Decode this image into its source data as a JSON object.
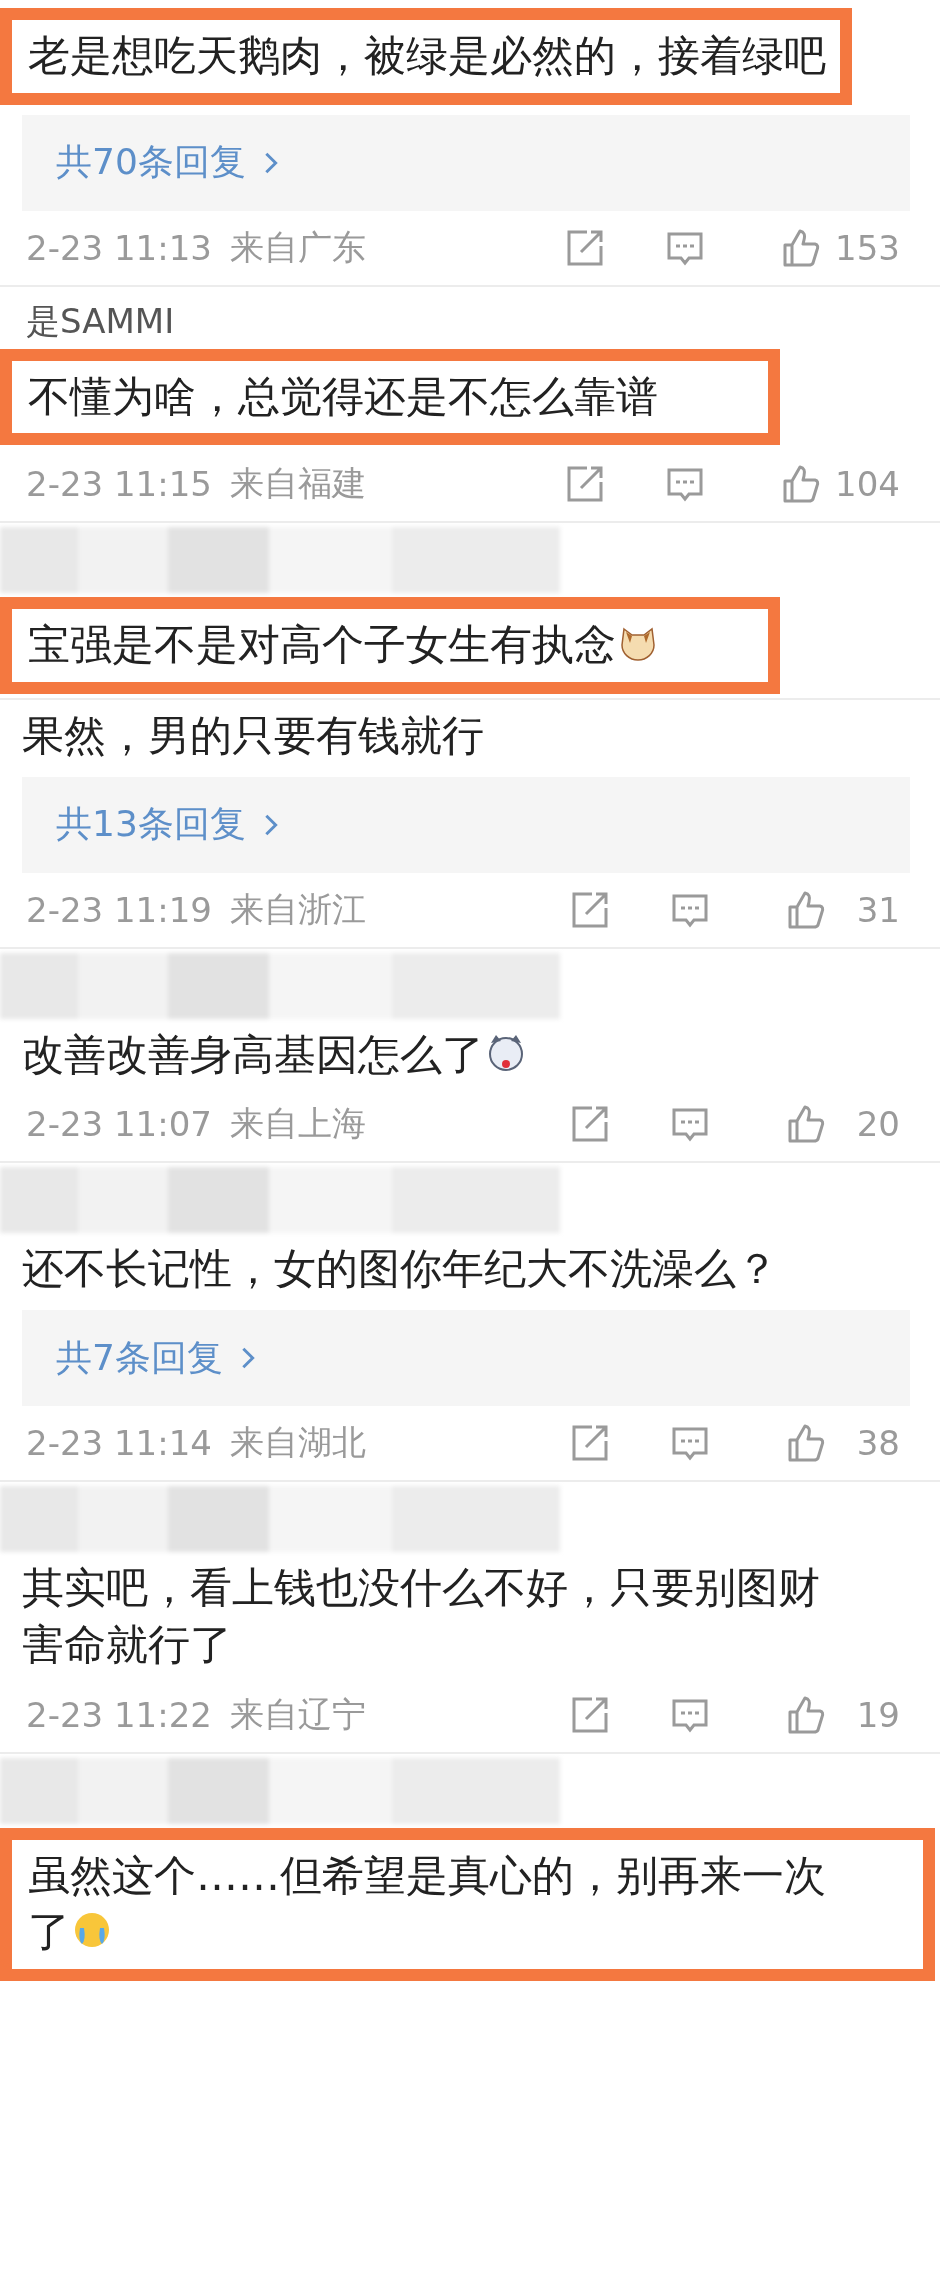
{
  "comments": [
    {
      "text": "老是想吃天鹅肉，被绿是必然的，接着绿吧",
      "highlighted": true,
      "replies": "共70条回复",
      "time": "2-23 11:13",
      "location": "来自广东",
      "likes": "153"
    },
    {
      "username": "是SAMMI",
      "text": "不懂为啥，总觉得还是不怎么靠谱",
      "highlighted": true,
      "time": "2-23 11:15",
      "location": "来自福建",
      "likes": "104"
    },
    {
      "blurred_header": true,
      "text": "宝强是不是对高个子女生有执念",
      "emoji": {
        "kind": "cat"
      },
      "highlighted": true
    },
    {
      "text": "果然，男的只要有钱就行",
      "highlighted": false,
      "replies": "共13条回复",
      "time": "2-23 11:19",
      "location": "来自浙江",
      "likes": "31"
    },
    {
      "blurred_header": true,
      "text": "改善改善身高基因怎么了",
      "emoji": {
        "kind": "dog"
      },
      "highlighted": false,
      "time": "2-23 11:07",
      "location": "来自上海",
      "likes": "20"
    },
    {
      "blurred_header": true,
      "text": "还不长记性，女的图你年纪大不洗澡么？",
      "highlighted": false,
      "replies": "共7条回复",
      "time": "2-23 11:14",
      "location": "来自湖北",
      "likes": "38"
    },
    {
      "blurred_header": true,
      "text": "其实吧，看上钱也没什么不好，只要别图财害命就行了",
      "highlighted": false,
      "time": "2-23 11:22",
      "location": "来自辽宁",
      "likes": "19"
    },
    {
      "blurred_header": true,
      "text": "虽然这个……但希望是真心的，别再来一次了",
      "emoji": {
        "kind": "crying"
      },
      "highlighted": true
    }
  ]
}
